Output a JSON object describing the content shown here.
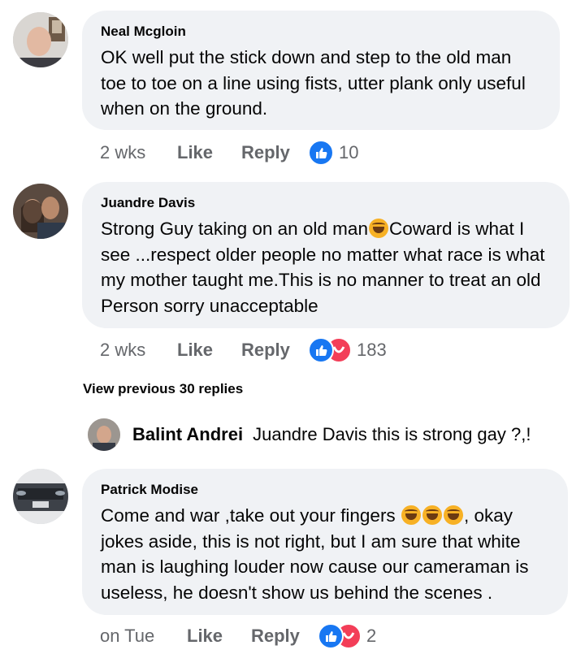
{
  "comments": [
    {
      "author": "Neal Mcgloin",
      "text": "OK well put the stick down and step to the old man toe to toe on a line using fists, utter plank only useful when on the ground.",
      "time": "2 wks",
      "like_label": "Like",
      "reply_label": "Reply",
      "reaction_count": "10",
      "reactions": [
        "like-icon"
      ]
    },
    {
      "author": "Juandre Davis",
      "text_part1": "Strong Guy taking on an old man",
      "text_part2": "Coward is what I see ...respect older people no matter what race is what my mother taught me.This is no manner to treat an old Person sorry unacceptable",
      "time": "2 wks",
      "like_label": "Like",
      "reply_label": "Reply",
      "reaction_count": "183",
      "reactions": [
        "like-icon",
        "haha-icon"
      ]
    },
    {
      "author": "Patrick Modise",
      "text_part1": "Come and war ,take out your fingers ",
      "text_part2": ", okay jokes aside, this is not right, but I am sure that white man is laughing louder now cause our cameraman is useless, he doesn't show us behind the scenes .",
      "time": "on Tue",
      "like_label": "Like",
      "reply_label": "Reply",
      "reaction_count": "2",
      "reactions": [
        "like-icon",
        "haha-icon"
      ]
    }
  ],
  "view_previous": "View previous 30 replies",
  "reply_preview": {
    "author": "Balint Andrei",
    "text": "Juandre Davis this is strong gay ?,!"
  },
  "colors": {
    "bubble": "#f0f2f5",
    "meta_text": "#65676b",
    "like_blue": "#1877f2",
    "haha_red": "#f33e58"
  }
}
